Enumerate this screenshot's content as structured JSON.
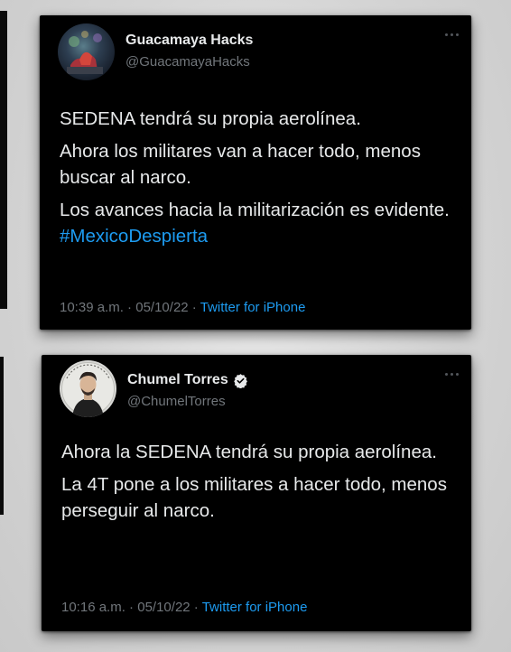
{
  "tweets": [
    {
      "name": "Guacamaya Hacks",
      "handle": "@GuacamayaHacks",
      "verified": false,
      "paragraphs": [
        "SEDENA tendrá su propia aerolínea.",
        "Ahora los militares van a hacer todo, menos buscar al narco.",
        "Los avances hacia la militarización es evidente. "
      ],
      "hashtag": "#MexicoDespierta",
      "time": "10:39 a.m.",
      "date": "05/10/22",
      "separator": " · ",
      "source": "Twitter for iPhone"
    },
    {
      "name": "Chumel Torres",
      "handle": "@ChumelTorres",
      "verified": true,
      "paragraphs": [
        "Ahora la SEDENA tendrá su propia aerolínea.",
        "La 4T pone a los militares a hacer todo, menos perseguir al narco."
      ],
      "time": "10:16 a.m.",
      "date": "05/10/22",
      "separator": " · ",
      "source": "Twitter for iPhone"
    }
  ],
  "icons": {
    "more": "more-horizontal-icon",
    "verified": "verified-badge-icon"
  },
  "colors": {
    "background": "#000000",
    "text": "#e7e9ea",
    "secondary": "#71767b",
    "link": "#1d9bf0",
    "verified": "#e7e9ea"
  }
}
